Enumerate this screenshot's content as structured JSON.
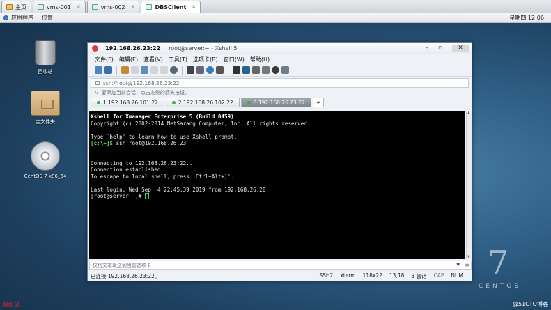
{
  "vm_tabs": [
    {
      "label": "主页",
      "icon": "home-icon",
      "active": false
    },
    {
      "label": "vms-001",
      "icon": "vm-icon",
      "active": false
    },
    {
      "label": "vms-002",
      "icon": "vm-icon",
      "active": false
    },
    {
      "label": "DBSClient",
      "icon": "vm-icon",
      "active": true
    }
  ],
  "panel": {
    "applications": "应用程序",
    "places": "位置",
    "clock": "星期四 12:06"
  },
  "desktop": {
    "trash": "回收站",
    "home": "主文件夹",
    "cd": "CentOS 7 x86_64"
  },
  "watermark": {
    "seven": "7",
    "centos": "CENTOS"
  },
  "credit": "@51CTO博客",
  "bottom_left": "黑松鼠",
  "xshell": {
    "title_host": "192.168.26.23:22",
    "title_rest": "root@server:~ - Xshell 5",
    "menu": [
      "文件(F)",
      "编辑(E)",
      "查看(V)",
      "工具(T)",
      "选项卡(B)",
      "窗口(W)",
      "帮助(H)"
    ],
    "address": "ssh://root@192.168.26.23:22",
    "hint": "要添加当前会话，点击左侧的箭头按钮。",
    "sessions": [
      "1 192.168.26.101:22",
      "2 192.168.26.102:22",
      "3 192.168.26.23:22"
    ],
    "active_session": 2,
    "terminal": {
      "l1": "Xshell for Xmanager Enterprise 5 (Build 0459)",
      "l2": "Copyright (c) 2002-2014 NetSarang Computer, Inc. All rights reserved.",
      "l3": "Type `help' to learn how to use Xshell prompt.",
      "l4_prompt": "[c:\\~]$",
      "l4_cmd": " ssh root@192.168.26.23",
      "l5": "Connecting to 192.168.26.23:22...",
      "l6": "Connection established.",
      "l7": "To escape to local shell, press 'Ctrl+Alt+]'.",
      "l8": "Last login: Wed Sep  4 22:45:39 2019 from 192.168.26.20",
      "l9": "[root@server ~]# "
    },
    "send_placeholder": "仅将文本发送到当前选项卡",
    "status": {
      "connected": "已连接 192.168.26.23:22。",
      "proto": "SSH2",
      "term": "xterm",
      "size": "118x22",
      "pos": "13,18",
      "sessions": "3 会话",
      "cap": "CAP",
      "num": "NUM"
    }
  },
  "colors": {
    "terminal_bg": "#000000",
    "prompt_green": "#6ee36e",
    "session_dot": "#2fb34a"
  }
}
